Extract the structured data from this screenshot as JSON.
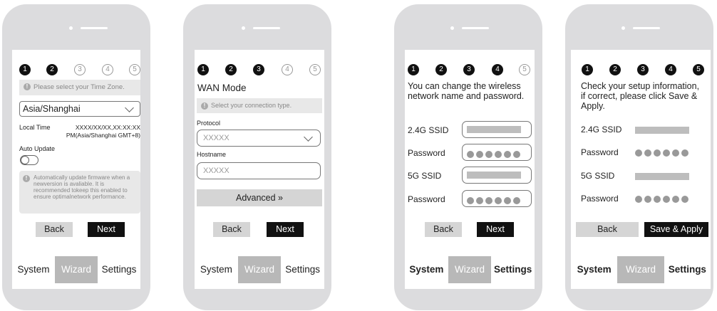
{
  "steps": [
    "1",
    "2",
    "3",
    "4",
    "5"
  ],
  "tabs": {
    "system": "System",
    "wizard": "Wizard",
    "settings": "Settings"
  },
  "screen1": {
    "info": "Please select your Time Zone.",
    "timezone": "Asia/Shanghai",
    "local_time_label": "Local Time",
    "local_time_line1": "XXXX/XX/XX,XX:XX:XX",
    "local_time_line2": "PM(Asia/Shanghai GMT+8)",
    "auto_update_label": "Auto Update",
    "auto_update_note": "Automatically update firmware when a newversion is avaliable. It is recommended tokeep this enabled to ensure optimalnetwork performance.",
    "back": "Back",
    "next": "Next"
  },
  "screen2": {
    "title": "WAN Mode",
    "info": "Select your connection type.",
    "protocol_label": "Protocol",
    "protocol_value": "XXXXX",
    "hostname_label": "Hostname",
    "hostname_value": "XXXXX",
    "advanced": "Advanced »",
    "back": "Back",
    "next": "Next"
  },
  "screen3": {
    "desc": "You can change the wireless network name and password.",
    "ssid24_label": "2.4G SSID",
    "password_label": "Password",
    "ssid5_label": "5G SSID",
    "back": "Back",
    "next": "Next"
  },
  "screen4": {
    "desc": "Check your setup information, if correct, please click Save & Apply.",
    "ssid24_label": "2.4G SSID",
    "password_label": "Password",
    "ssid5_label": "5G SSID",
    "back": "Back",
    "save": "Save & Apply"
  }
}
